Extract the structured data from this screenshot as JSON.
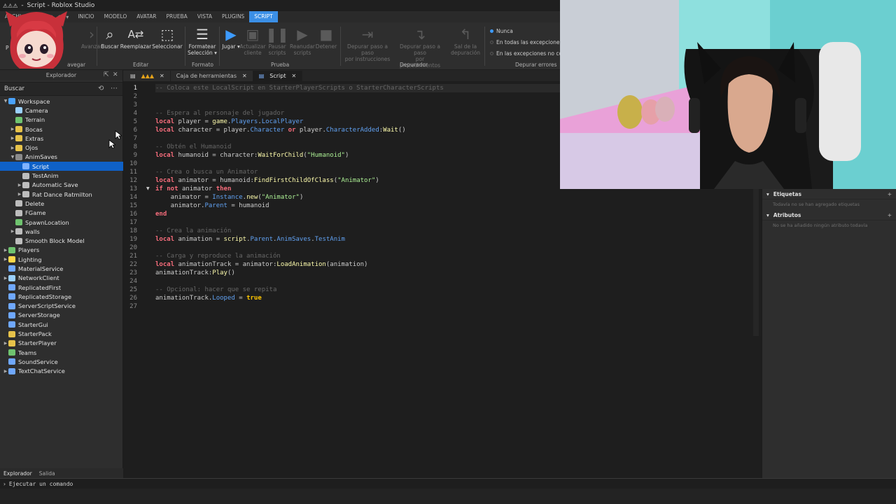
{
  "window": {
    "title": "Script - Roblox Studio",
    "file_menu": "ARCHI"
  },
  "menu": [
    "INICIO",
    "MODELO",
    "AVATAR",
    "PRUEBA",
    "VISTA",
    "PLUGINS",
    "SCRIPT"
  ],
  "menu_active_index": 6,
  "ribbon": {
    "navigate_group": "avegar",
    "nav_back": "P",
    "nav_forward": "Avanzar",
    "find": "Buscar",
    "replace": "Reemplazar",
    "select": "Seleccionar",
    "edit_group": "Editar",
    "format": "Formatear",
    "format2": "Selección",
    "format_group": "Formato",
    "play": "Jugar",
    "stop_client": "Actualizar",
    "stop_client2": "cliente",
    "pause": "Pausar",
    "pause2": "scripts",
    "resume": "Reanudar",
    "resume2": "scripts",
    "stop": "Detener",
    "test_group": "Prueba",
    "step_over": "Depurar paso a paso",
    "step_over2": "por instrucciones",
    "step_into": "Depurar paso a paso",
    "step_into2": "por procedimientos",
    "step_out": "Sal de la",
    "step_out2": "depuración",
    "debugger_group": "Depurador",
    "never": "Nunca",
    "all_exceptions": "En todas las excepciones",
    "uncaught": "En las excepciones no cont",
    "errors_group": "Depurar errores"
  },
  "explorer": {
    "title": "Explorador",
    "search_placeholder": "Buscar",
    "bottom_tabs": [
      "Explorador",
      "Salida"
    ],
    "items": [
      {
        "label": "Workspace",
        "depth": 0,
        "arrow": "down",
        "color": "#4aa3ff"
      },
      {
        "label": "Camera",
        "depth": 1,
        "arrow": "",
        "color": "#9ad0ff"
      },
      {
        "label": "Terrain",
        "depth": 1,
        "arrow": "",
        "color": "#6fc36f"
      },
      {
        "label": "Bocas",
        "depth": 1,
        "arrow": "right",
        "color": "#e6c24a"
      },
      {
        "label": "Extras",
        "depth": 1,
        "arrow": "right",
        "color": "#e6c24a"
      },
      {
        "label": "Ojos",
        "depth": 1,
        "arrow": "right",
        "color": "#e6c24a"
      },
      {
        "label": "AnimSaves",
        "depth": 1,
        "arrow": "down",
        "color": "#8a8a8a"
      },
      {
        "label": "Script",
        "depth": 2,
        "arrow": "",
        "color": "#7fb3ff",
        "selected": true
      },
      {
        "label": "TestAnim",
        "depth": 2,
        "arrow": "",
        "color": "#bdbdbd"
      },
      {
        "label": "Automatic Save",
        "depth": 2,
        "arrow": "right",
        "color": "#bdbdbd"
      },
      {
        "label": "Rat Dance Ratmilton",
        "depth": 2,
        "arrow": "right",
        "color": "#bdbdbd"
      },
      {
        "label": "Delete",
        "depth": 1,
        "arrow": "",
        "color": "#bdbdbd"
      },
      {
        "label": "FGame",
        "depth": 1,
        "arrow": "",
        "color": "#bdbdbd"
      },
      {
        "label": "SpawnLocation",
        "depth": 1,
        "arrow": "",
        "color": "#6fc36f"
      },
      {
        "label": "walls",
        "depth": 1,
        "arrow": "right",
        "color": "#bdbdbd"
      },
      {
        "label": "Smooth Block Model",
        "depth": 1,
        "arrow": "",
        "color": "#bdbdbd"
      },
      {
        "label": "Players",
        "depth": 0,
        "arrow": "right",
        "color": "#6fc36f"
      },
      {
        "label": "Lighting",
        "depth": 0,
        "arrow": "right",
        "color": "#ffd84a"
      },
      {
        "label": "MaterialService",
        "depth": 0,
        "arrow": "",
        "color": "#6fa8ff"
      },
      {
        "label": "NetworkClient",
        "depth": 0,
        "arrow": "right",
        "color": "#9ad0ff"
      },
      {
        "label": "ReplicatedFirst",
        "depth": 0,
        "arrow": "",
        "color": "#6fa8ff"
      },
      {
        "label": "ReplicatedStorage",
        "depth": 0,
        "arrow": "",
        "color": "#6fa8ff"
      },
      {
        "label": "ServerScriptService",
        "depth": 0,
        "arrow": "",
        "color": "#6fa8ff"
      },
      {
        "label": "ServerStorage",
        "depth": 0,
        "arrow": "",
        "color": "#6fa8ff"
      },
      {
        "label": "StarterGui",
        "depth": 0,
        "arrow": "",
        "color": "#6fa8ff"
      },
      {
        "label": "StarterPack",
        "depth": 0,
        "arrow": "",
        "color": "#e6c24a"
      },
      {
        "label": "StarterPlayer",
        "depth": 0,
        "arrow": "right",
        "color": "#e6c24a"
      },
      {
        "label": "Teams",
        "depth": 0,
        "arrow": "",
        "color": "#6fc36f"
      },
      {
        "label": "SoundService",
        "depth": 0,
        "arrow": "",
        "color": "#6fa8ff"
      },
      {
        "label": "TextChatService",
        "depth": 0,
        "arrow": "right",
        "color": "#6fa8ff"
      }
    ]
  },
  "editor": {
    "tabs": [
      {
        "label": "",
        "kind": "warnings"
      },
      {
        "label": "Caja de herramientas",
        "kind": "toolbox"
      },
      {
        "label": "Script",
        "kind": "script",
        "active": true
      }
    ],
    "current_line": 1,
    "fold_line": 13,
    "lines": [
      [
        [
          "cm",
          "-- Coloca este LocalScript en StarterPlayerScripts o StarterCharacterScripts"
        ]
      ],
      [],
      [],
      [
        [
          "cm",
          "-- Espera al personaje del jugador"
        ]
      ],
      [
        [
          "kw",
          "local"
        ],
        [
          "",
          " player = "
        ],
        [
          "fn",
          "game"
        ],
        [
          "",
          "."
        ],
        [
          "pr",
          "Players"
        ],
        [
          "",
          "."
        ],
        [
          "pr",
          "LocalPlayer"
        ]
      ],
      [
        [
          "kw",
          "local"
        ],
        [
          "",
          " character = player."
        ],
        [
          "pr",
          "Character"
        ],
        [
          "",
          " "
        ],
        [
          "kw",
          "or"
        ],
        [
          "",
          " player."
        ],
        [
          "pr",
          "CharacterAdded"
        ],
        [
          "",
          ":"
        ],
        [
          "fn",
          "Wait"
        ],
        [
          "",
          "()"
        ]
      ],
      [],
      [
        [
          "cm",
          "-- Obtén el Humanoid"
        ]
      ],
      [
        [
          "kw",
          "local"
        ],
        [
          "",
          " humanoid = character:"
        ],
        [
          "fn",
          "WaitForChild"
        ],
        [
          "",
          "("
        ],
        [
          "str",
          "\"Humanoid\""
        ],
        [
          "",
          ")"
        ]
      ],
      [],
      [
        [
          "cm",
          "-- Crea o busca un Animator"
        ]
      ],
      [
        [
          "kw",
          "local"
        ],
        [
          "",
          " animator = humanoid:"
        ],
        [
          "fn",
          "FindFirstChildOfClass"
        ],
        [
          "",
          "("
        ],
        [
          "str",
          "\"Animator\""
        ],
        [
          "",
          ")"
        ]
      ],
      [
        [
          "kw",
          "if"
        ],
        [
          "",
          " "
        ],
        [
          "kw",
          "not"
        ],
        [
          "",
          " animator "
        ],
        [
          "kw",
          "then"
        ]
      ],
      [
        [
          "",
          "    animator = "
        ],
        [
          "pr",
          "Instance"
        ],
        [
          "",
          "."
        ],
        [
          "fn",
          "new"
        ],
        [
          "",
          "("
        ],
        [
          "str",
          "\"Animator\""
        ],
        [
          "",
          ")"
        ]
      ],
      [
        [
          "",
          "    animator."
        ],
        [
          "pr",
          "Parent"
        ],
        [
          "",
          " = humanoid"
        ]
      ],
      [
        [
          "kw",
          "end"
        ]
      ],
      [],
      [
        [
          "cm",
          "-- Crea la animación"
        ]
      ],
      [
        [
          "kw",
          "local"
        ],
        [
          "",
          " animation = "
        ],
        [
          "fn",
          "script"
        ],
        [
          "",
          "."
        ],
        [
          "pr",
          "Parent"
        ],
        [
          "",
          "."
        ],
        [
          "pr",
          "AnimSaves"
        ],
        [
          "",
          "."
        ],
        [
          "pr",
          "TestAnim"
        ]
      ],
      [],
      [
        [
          "cm",
          "-- Carga y reproduce la animación"
        ]
      ],
      [
        [
          "kw",
          "local"
        ],
        [
          "",
          " animationTrack = animator:"
        ],
        [
          "fn",
          "LoadAnimation"
        ],
        [
          "",
          "(animation)"
        ]
      ],
      [
        [
          "",
          "animationTrack:"
        ],
        [
          "fn",
          "Play"
        ],
        [
          "",
          "()"
        ]
      ],
      [],
      [
        [
          "cm",
          "-- Opcional: hacer que se repita"
        ]
      ],
      [
        [
          "",
          "animationTrack."
        ],
        [
          "pr",
          "Looped"
        ],
        [
          "",
          " = "
        ],
        [
          "bool",
          "true"
        ]
      ],
      []
    ]
  },
  "properties": {
    "tags_title": "Etiquetas",
    "tags_empty": "Todavía no se han agregado etiquetas",
    "attrs_title": "Atributos",
    "attrs_empty": "No se ha añadido ningún atributo todavía"
  },
  "command_bar": {
    "placeholder": "Ejecutar un comando"
  }
}
